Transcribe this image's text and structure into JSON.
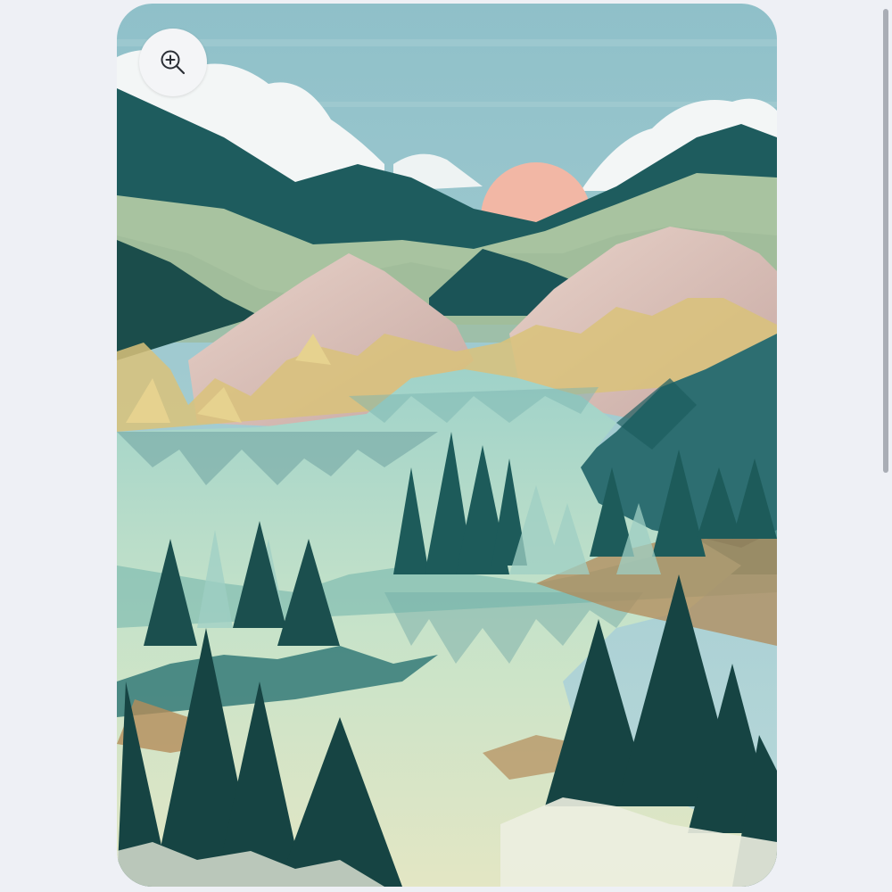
{
  "artwork": {
    "subject": "mountain-lake-landscape-illustration",
    "palette": {
      "sky": "#9cc8cf",
      "sun": "#f2b7a5",
      "deep_teal": "#1d5a5a",
      "sage": "#a9c4a2",
      "rock_pink": "#d9bfb8",
      "lake": "#b7ddd0",
      "gold": "#d9c27a",
      "pine": "#15413f"
    }
  },
  "zoom_button": {
    "icon": "zoom-in-icon"
  },
  "scrollbar": {
    "position_fraction": 0.0
  }
}
